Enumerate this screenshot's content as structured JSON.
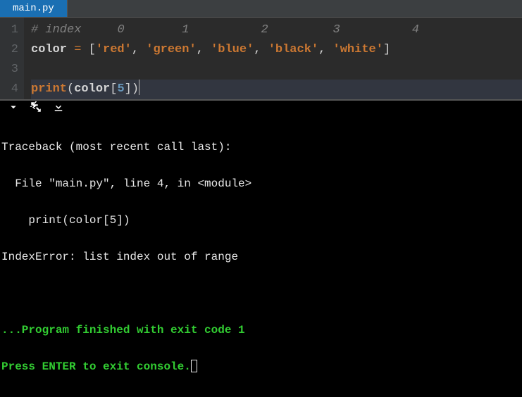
{
  "tab": {
    "filename": "main.py"
  },
  "gutter": [
    "1",
    "2",
    "3",
    "4"
  ],
  "code": {
    "line1": {
      "comment_lead": "# index",
      "idx0": "0",
      "idx1": "1",
      "idx2": "2",
      "idx3": "3",
      "idx4": "4"
    },
    "line2": {
      "var": "color",
      "assign": " = ",
      "lb": "[",
      "s0": "'red'",
      "s1": "'green'",
      "s2": "'blue'",
      "s3": "'black'",
      "s4": "'white'",
      "comma": ", ",
      "rb": "]"
    },
    "line4": {
      "fn": "print",
      "lp": "(",
      "var": "color",
      "lbr": "[",
      "num": "5",
      "rbr": "]",
      "rp": ")"
    }
  },
  "console": {
    "l1": "Traceback (most recent call last):",
    "l2": "  File \"main.py\", line 4, in <module>",
    "l3": "    print(color[5])",
    "l4": "IndexError: list index out of range",
    "blank": "",
    "l6": "...Program finished with exit code 1",
    "l7": "Press ENTER to exit console."
  }
}
